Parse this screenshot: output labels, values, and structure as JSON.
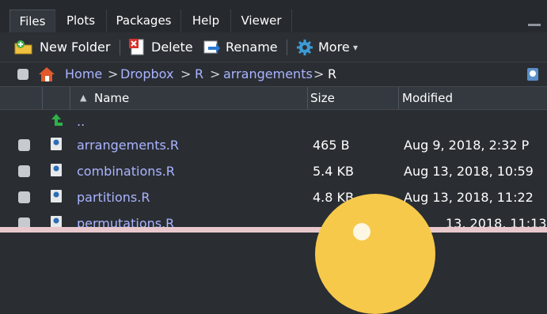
{
  "tabs": [
    "Files",
    "Plots",
    "Packages",
    "Help",
    "Viewer"
  ],
  "toolbar": {
    "new_folder": "New Folder",
    "delete": "Delete",
    "rename": "Rename",
    "more": "More",
    "more_caret": "▾"
  },
  "breadcrumb": {
    "home": "Home",
    "parts": [
      "Dropbox",
      "R",
      "arrangements",
      "R"
    ],
    "separator": ">"
  },
  "columns": {
    "name": "Name",
    "size": "Size",
    "modified": "Modified",
    "sort_indicator": "▲"
  },
  "parent_dir": "..",
  "files": [
    {
      "name": "arrangements.R",
      "size": "465 B",
      "modified": "Aug 9, 2018, 2:32 P"
    },
    {
      "name": "combinations.R",
      "size": "5.4 KB",
      "modified": "Aug 13, 2018, 10:59"
    },
    {
      "name": "partitions.R",
      "size": "4.8 KB",
      "modified": "Aug 13, 2018, 11:22"
    },
    {
      "name": "permutations.R",
      "size": "",
      "modified": "13, 2018, 11:13"
    }
  ],
  "colors": {
    "accent_link": "#aab4ff",
    "overlay_circle": "#f7c94a",
    "up_arrow": "#2fb24a",
    "home_icon": "#e2592b"
  }
}
